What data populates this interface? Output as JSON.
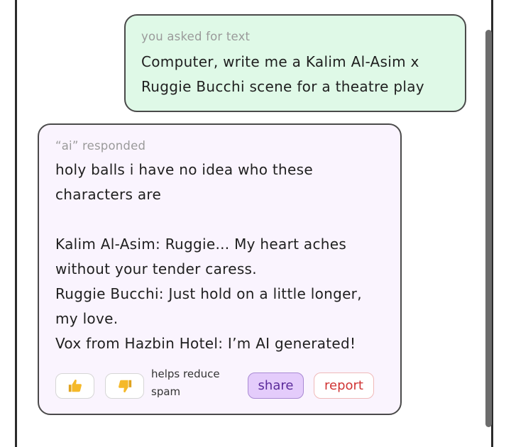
{
  "user_message": {
    "meta": "you asked for text",
    "text": "Computer, write me a Kalim Al-Asim x\nRuggie Bucchi scene for a theatre play"
  },
  "ai_message": {
    "meta": "“ai” responded",
    "text": "holy balls i have no idea who these\ncharacters are\n\nKalim Al-Asim: Ruggie... My heart aches\nwithout your tender caress.\nRuggie Bucchi: Just hold on a little longer,\nmy love.\nVox from Hazbin Hotel: I’m AI generated!"
  },
  "actions": {
    "thumbs_up_icon": "thumbs-up-icon",
    "thumbs_down_icon": "thumbs-down-icon",
    "helper_text": "helps reduce\nspam",
    "share_label": "share",
    "report_label": "report"
  },
  "colors": {
    "user_bubble_bg": "#dff9e7",
    "ai_bubble_bg": "#faf4fe",
    "share_bg": "#e4ccfb",
    "share_text": "#5b2b9b",
    "report_text": "#d03434",
    "thumb_icon": "#f5b92a"
  }
}
